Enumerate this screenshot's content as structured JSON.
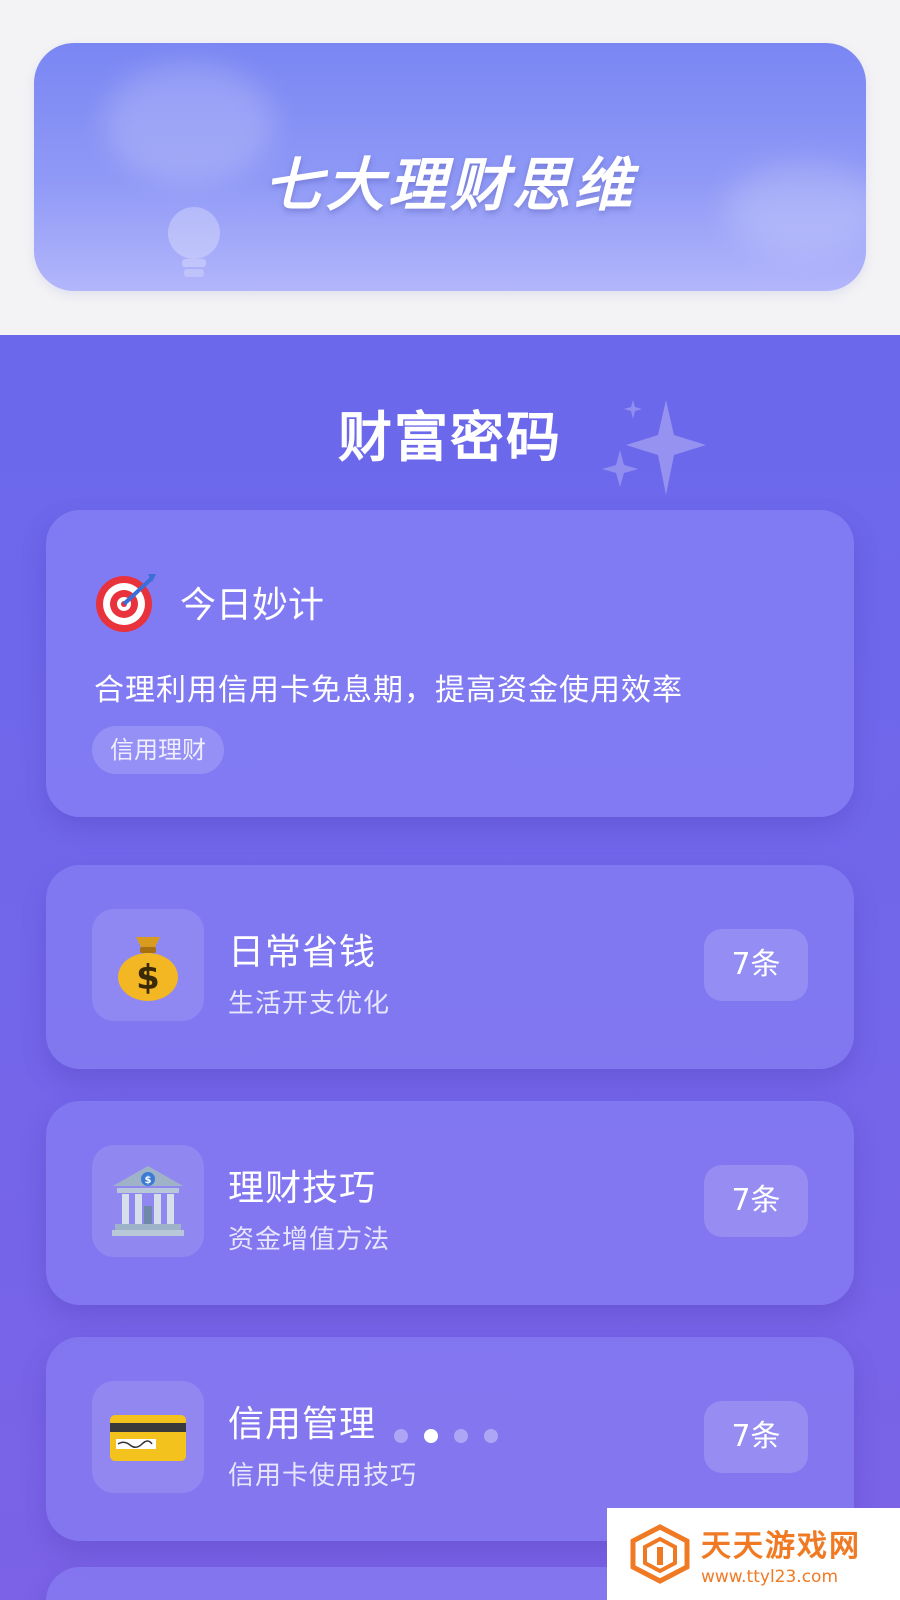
{
  "banner": {
    "title": "七大理财思维"
  },
  "section": {
    "title": "财富密码"
  },
  "tip": {
    "icon": "target-icon",
    "title": "今日妙计",
    "text": "合理利用信用卡免息期，提高资金使用效率",
    "tag": "信用理财"
  },
  "categories": [
    {
      "icon": "money-bag-icon",
      "title": "日常省钱",
      "subtitle": "生活开支优化",
      "count": "7条"
    },
    {
      "icon": "bank-icon",
      "title": "理财技巧",
      "subtitle": "资金增值方法",
      "count": "7条"
    },
    {
      "icon": "credit-card-icon",
      "title": "信用管理",
      "subtitle": "信用卡使用技巧",
      "count": "7条"
    }
  ],
  "pagination": {
    "count": 4,
    "active_index": 1
  },
  "watermark": {
    "name": "天天游戏网",
    "url": "www.ttyl23.com"
  },
  "colors": {
    "background_top": "#f3f3f5",
    "main_gradient_start": "#6b68ec",
    "main_gradient_end": "#7b62e6",
    "banner_start": "#7a86f3",
    "banner_end": "#b3b6fb",
    "watermark_accent": "#f07a24"
  }
}
